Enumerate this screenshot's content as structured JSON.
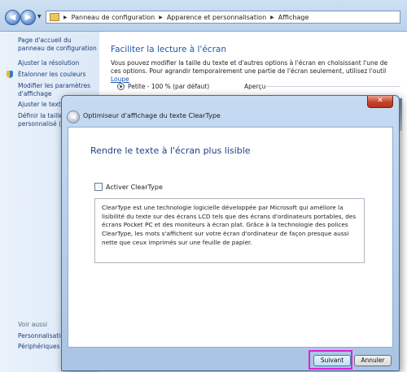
{
  "address": {
    "crumbs": [
      "Panneau de configuration",
      "Apparence et personnalisation",
      "Affichage"
    ]
  },
  "sidebar": {
    "items": [
      {
        "label": "Page d'accueil du panneau de configuration"
      },
      {
        "label": "Ajuster la résolution"
      },
      {
        "label": "Étalonner les couleurs"
      },
      {
        "label": "Modifier les paramètres d'affichage"
      },
      {
        "label": "Ajuster le texte Cl"
      },
      {
        "label": "Définir la taille du personnalisé (PPP)"
      }
    ],
    "see_also_heading": "Voir aussi",
    "see_also": [
      {
        "label": "Personnalisation"
      },
      {
        "label": "Périphériques et i"
      }
    ]
  },
  "main": {
    "title": "Faciliter la lecture à l'écran",
    "description": "Vous pouvez modifier la taille du texte et d'autres options à l'écran en choisissant l'une de ces options. Pour agrandir temporairement une partie de l'écran seulement, utilisez l'outil",
    "loupe_link": "Loupe",
    "option_label": "Petite - 100 % (par défaut)",
    "preview_label": "Aperçu"
  },
  "dialog": {
    "close_glyph": "✕",
    "title": "Optimiseur d'affichage du texte ClearType",
    "heading": "Rendre le texte à l'écran plus lisible",
    "checkbox_label": "Activer ClearType",
    "checkbox_checked": false,
    "description": "ClearType est une technologie logicielle développée par Microsoft qui améliore la lisibilité du texte sur des écrans LCD tels que des écrans d'ordinateurs portables, des écrans Pocket PC et des moniteurs à écran plat. Grâce à la technologie des polices ClearType, les mots s'affichent sur votre écran d'ordinateur de façon presque aussi nette que ceux imprimés sur une feuille de papier.",
    "next_button": "Suivant",
    "cancel_button": "Annuler",
    "highlight_color": "#e21fd9"
  }
}
